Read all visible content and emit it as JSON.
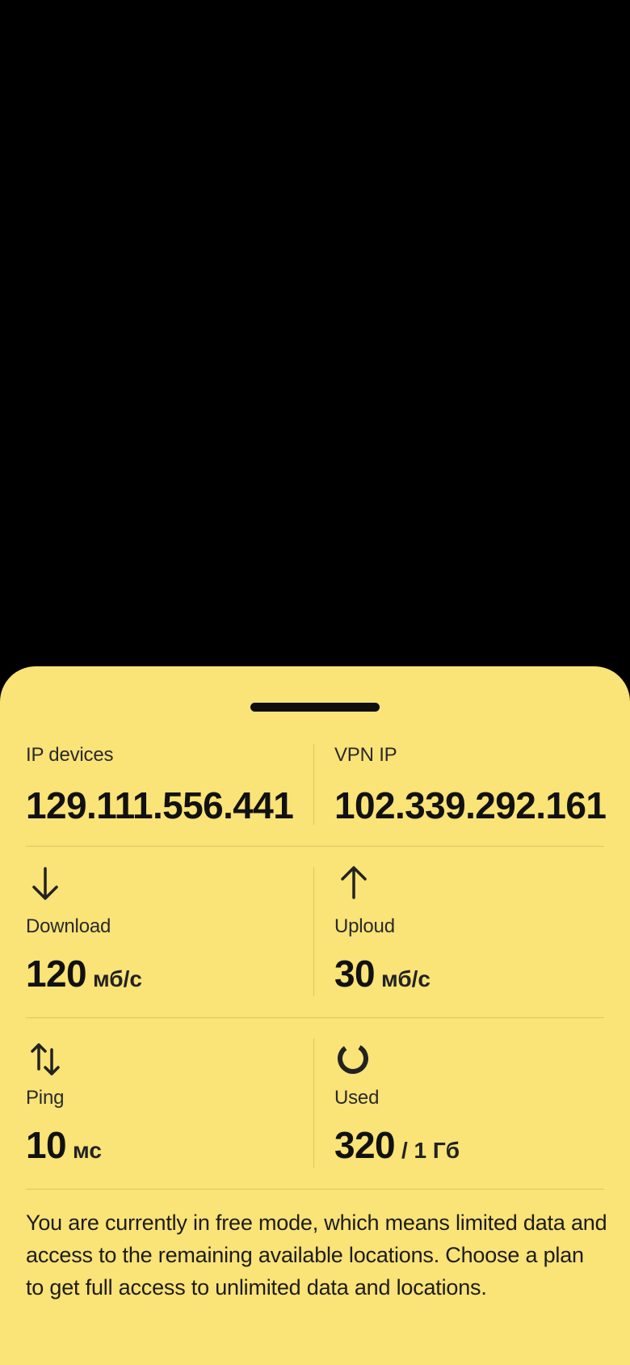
{
  "ip_row": {
    "device": {
      "label": "IP devices",
      "value": "129.111.556.441"
    },
    "vpn": {
      "label": "VPN IP",
      "value": "102.339.292.161"
    }
  },
  "speed_row": {
    "download": {
      "icon": "arrow-down-icon",
      "label": "Download",
      "value": "120",
      "unit": "мб/с"
    },
    "upload": {
      "icon": "arrow-up-icon",
      "label": "Uploud",
      "value": "30",
      "unit": "мб/с"
    }
  },
  "usage_row": {
    "ping": {
      "icon": "arrows-up-down-icon",
      "label": "Ping",
      "value": "10",
      "unit": "мс"
    },
    "used": {
      "icon": "circle-progress-icon",
      "label": "Used",
      "value": "320",
      "unit": "/ 1 Гб"
    }
  },
  "note": "You are currently in free mode, which means limited data and access to the remaining available locations. Choose a plan to get full access to unlimited data and locations.",
  "colors": {
    "sheet": "#FAE377",
    "background": "#000000",
    "text": "#111111",
    "divider": "#DCC766"
  }
}
